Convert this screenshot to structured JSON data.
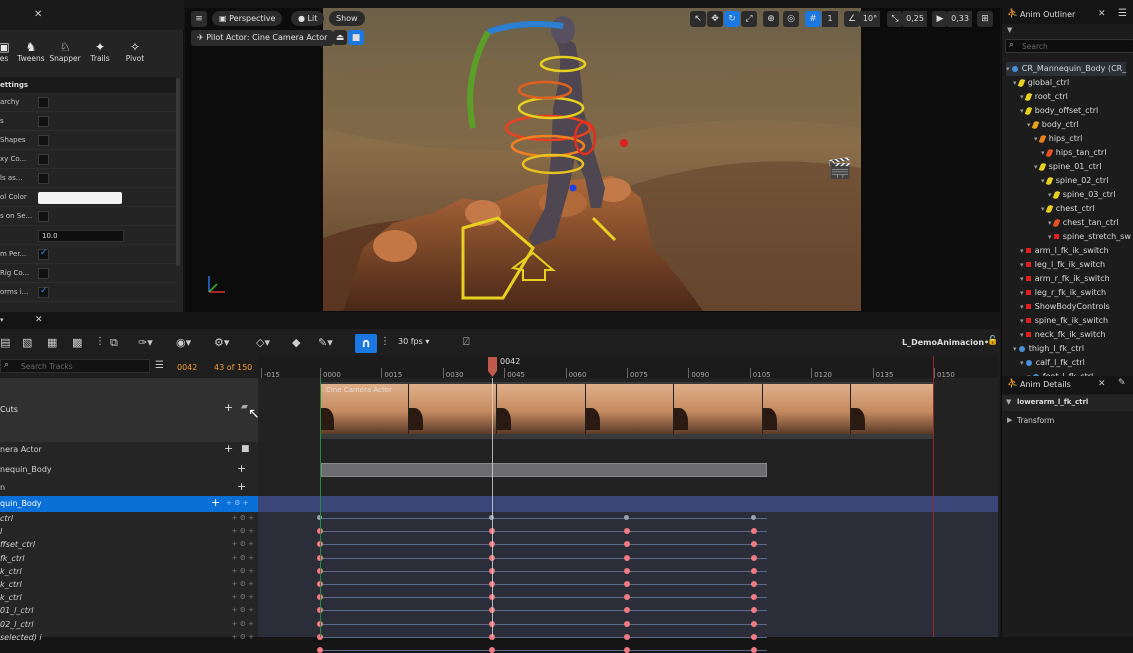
{
  "left_panel": {
    "tools": [
      {
        "label": "es"
      },
      {
        "label": "Tweens"
      },
      {
        "label": "Snapper"
      },
      {
        "label": "Trails"
      },
      {
        "label": "Pivot"
      }
    ],
    "section_title": "ettings",
    "rows": [
      {
        "label": "archy",
        "checked": false
      },
      {
        "label": "s",
        "checked": false
      },
      {
        "label": "Shapes",
        "checked": false
      },
      {
        "label": "xy Co...",
        "checked": false
      },
      {
        "label": "ls as...",
        "checked": false
      },
      {
        "label": "ol Color",
        "type": "color"
      },
      {
        "label": "s on Se...",
        "checked": false
      },
      {
        "label": "",
        "type": "number",
        "value": "10.0"
      },
      {
        "label": "m Per...",
        "checked": true
      },
      {
        "label": "Rig Co...",
        "checked": false
      },
      {
        "label": "orms i...",
        "checked": true
      }
    ]
  },
  "viewport": {
    "perspective_label": "Perspective",
    "lit_label": "Lit",
    "show_label": "Show",
    "pilot_label": "Pilot Actor: Cine Camera Actor",
    "grid_value": "1",
    "angle_value": "10°",
    "scale_value": "0,25",
    "camera_speed": "0,33"
  },
  "outliner": {
    "title": "Anim Outliner",
    "search_placeholder": "Search",
    "items": [
      {
        "label": "CR_Mannequin_Body (CR_",
        "indent": 0,
        "icon": "dot",
        "color": "#4a90d9",
        "selected": true
      },
      {
        "label": "global_ctrl",
        "indent": 1,
        "icon": "leaf",
        "color": "#e8d020"
      },
      {
        "label": "root_ctrl",
        "indent": 2,
        "icon": "leaf",
        "color": "#e8d020"
      },
      {
        "label": "body_offset_ctrl",
        "indent": 2,
        "icon": "leaf",
        "color": "#e8d020"
      },
      {
        "label": "body_ctrl",
        "indent": 3,
        "icon": "leaf",
        "color": "#e8a020"
      },
      {
        "label": "hips_ctrl",
        "indent": 4,
        "icon": "leaf",
        "color": "#e88020"
      },
      {
        "label": "hips_tan_ctrl",
        "indent": 5,
        "icon": "leaf",
        "color": "#e85020"
      },
      {
        "label": "spine_01_ctrl",
        "indent": 4,
        "icon": "leaf",
        "color": "#e8d020"
      },
      {
        "label": "spine_02_ctrl",
        "indent": 5,
        "icon": "leaf",
        "color": "#e8d020"
      },
      {
        "label": "spine_03_ctrl",
        "indent": 6,
        "icon": "leaf",
        "color": "#e8d020"
      },
      {
        "label": "chest_ctrl",
        "indent": 5,
        "icon": "leaf",
        "color": "#e8d020"
      },
      {
        "label": "chest_tan_ctrl",
        "indent": 6,
        "icon": "leaf",
        "color": "#e85020"
      },
      {
        "label": "spine_stretch_sw",
        "indent": 6,
        "icon": "sq",
        "color": "#e02020"
      },
      {
        "label": "arm_l_fk_ik_switch",
        "indent": 2,
        "icon": "sq",
        "color": "#e02020"
      },
      {
        "label": "leg_l_fk_ik_switch",
        "indent": 2,
        "icon": "sq",
        "color": "#e02020"
      },
      {
        "label": "arm_r_fk_ik_switch",
        "indent": 2,
        "icon": "sq",
        "color": "#e02020"
      },
      {
        "label": "leg_r_fk_ik_switch",
        "indent": 2,
        "icon": "sq",
        "color": "#e02020"
      },
      {
        "label": "ShowBodyControls",
        "indent": 2,
        "icon": "sq",
        "color": "#e02020"
      },
      {
        "label": "spine_fk_ik_switch",
        "indent": 2,
        "icon": "sq",
        "color": "#e02020"
      },
      {
        "label": "neck_fk_ik_switch",
        "indent": 2,
        "icon": "sq",
        "color": "#e02020"
      },
      {
        "label": "thigh_l_fk_ctrl",
        "indent": 1,
        "icon": "none",
        "color": "#4a90d9"
      },
      {
        "label": "calf_l_fk_ctrl",
        "indent": 2,
        "icon": "none",
        "color": "#4a90d9"
      },
      {
        "label": "foot_l_fk_ctrl",
        "indent": 3,
        "icon": "none",
        "color": "#4a90d9"
      }
    ]
  },
  "details": {
    "title": "Anim Details",
    "control_name": "lowerarm_l_fk_ctrl",
    "section": "Transform"
  },
  "sequencer": {
    "fps_label": "30 fps",
    "sequence_name": "L_DemoAnimacion•",
    "search_placeholder": "Search Tracks",
    "current_frame": "0042",
    "frame_count": "43 of 150",
    "playhead_label": "0042",
    "ruler_ticks": [
      "-015",
      "0000",
      "0015",
      "0030",
      "0045",
      "0060",
      "0075",
      "0090",
      "0105",
      "0120",
      "0135",
      "0150"
    ],
    "camera_cut_label": "Cine Camera Actor",
    "tracks": [
      {
        "label": "Cuts"
      },
      {
        "label": "nera Actor"
      },
      {
        "label": "nequin_Body"
      },
      {
        "label": "n"
      },
      {
        "label": "quin_Body"
      }
    ],
    "controls": [
      "ctrl",
      "l",
      "ffset_ctrl",
      "fk_ctrl",
      "k_ctrl",
      "k_ctrl",
      "k_ctrl",
      "01_l_ctrl",
      "02_l_ctrl",
      "selected) i"
    ],
    "key_frames": [
      0,
      42,
      75,
      106
    ]
  },
  "colors": {
    "accent": "#2f8dff",
    "selected_row": "#0a6fd6",
    "key": "#f07a80",
    "playhead": "#c05a4a"
  }
}
